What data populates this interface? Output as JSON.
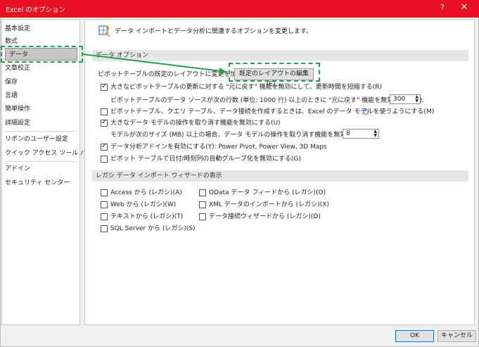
{
  "window": {
    "title": "Excel のオプション",
    "help_glyph": "?",
    "close_glyph": "✕"
  },
  "sidebar": {
    "items": [
      {
        "label": "基本設定"
      },
      {
        "label": "数式"
      },
      {
        "label": "データ"
      },
      {
        "label": "文章校正"
      },
      {
        "label": "保存"
      },
      {
        "label": "言語"
      },
      {
        "label": "簡単操作"
      },
      {
        "label": "詳細設定"
      },
      {
        "label": "リボンのユーザー設定"
      },
      {
        "label": "クイック アクセス ツール バー"
      },
      {
        "label": "アドイン"
      },
      {
        "label": "セキュリティ センター"
      }
    ],
    "active_index": 2
  },
  "content": {
    "header": "データ インポートとデータ分析に関連するオプションを変更します。",
    "data_options": {
      "section_title": "データ オプション",
      "layout_label": "ピボットテーブルの既定のレイアウトに変更を加えます:",
      "layout_button": "既定のレイアウトの編集(E)...",
      "large_pivot_label": "大きなピボットテーブルの更新に対する \"元に戻す\" 機能を無効にして、更新時間を短縮する(R)",
      "large_pivot_checked": true,
      "rows_label": "ピボットテーブルのデータ ソースが次の行数 (単位: 1000 行) 以上のときに \"元に戻す\" 機能を無効にする(N):",
      "rows_value": "300",
      "model_label": "ピボットテーブル、クエリ テーブル、データ接続を作成するときは、Excel のデータ モデルを使うようにする(M)",
      "model_checked": false,
      "large_model_label": "大きなデータ モデルの操作を取り消す機能を無効にする(U)",
      "large_model_checked": true,
      "size_label": "モデルが次のサイズ (MB) 以上の場合、データ モデルの操作を取り消す機能を無効にする(L):",
      "size_value": "8",
      "addins_label": "データ分析アドインを有効にする(Y): Power Pivot, Power View, 3D Maps",
      "addins_checked": true,
      "datetime_label": "ピボット テーブルで日付/時刻列の自動グループ化を無効にする(G)",
      "datetime_checked": false
    },
    "legacy": {
      "section_title": "レガシ データ インポート ウィザードの表示",
      "left": [
        {
          "label": "Access から (レガシ)(A)",
          "checked": false
        },
        {
          "label": "Web から (レガシ)(W)",
          "checked": false
        },
        {
          "label": "テキストから (レガシ)(T)",
          "checked": false
        },
        {
          "label": "SQL Server から (レガシ)(S)",
          "checked": false
        }
      ],
      "right": [
        {
          "label": "OData データ フィードから (レガシ)(O)",
          "checked": false
        },
        {
          "label": "XML データのインポートから (レガシ)(X)",
          "checked": false
        },
        {
          "label": "データ接続ウィザードから (レガシ)(D)",
          "checked": false
        }
      ]
    }
  },
  "footer": {
    "ok": "OK",
    "cancel": "キャンセル"
  },
  "colors": {
    "titlebar": "#e81123",
    "annotation": "#22a04b"
  }
}
